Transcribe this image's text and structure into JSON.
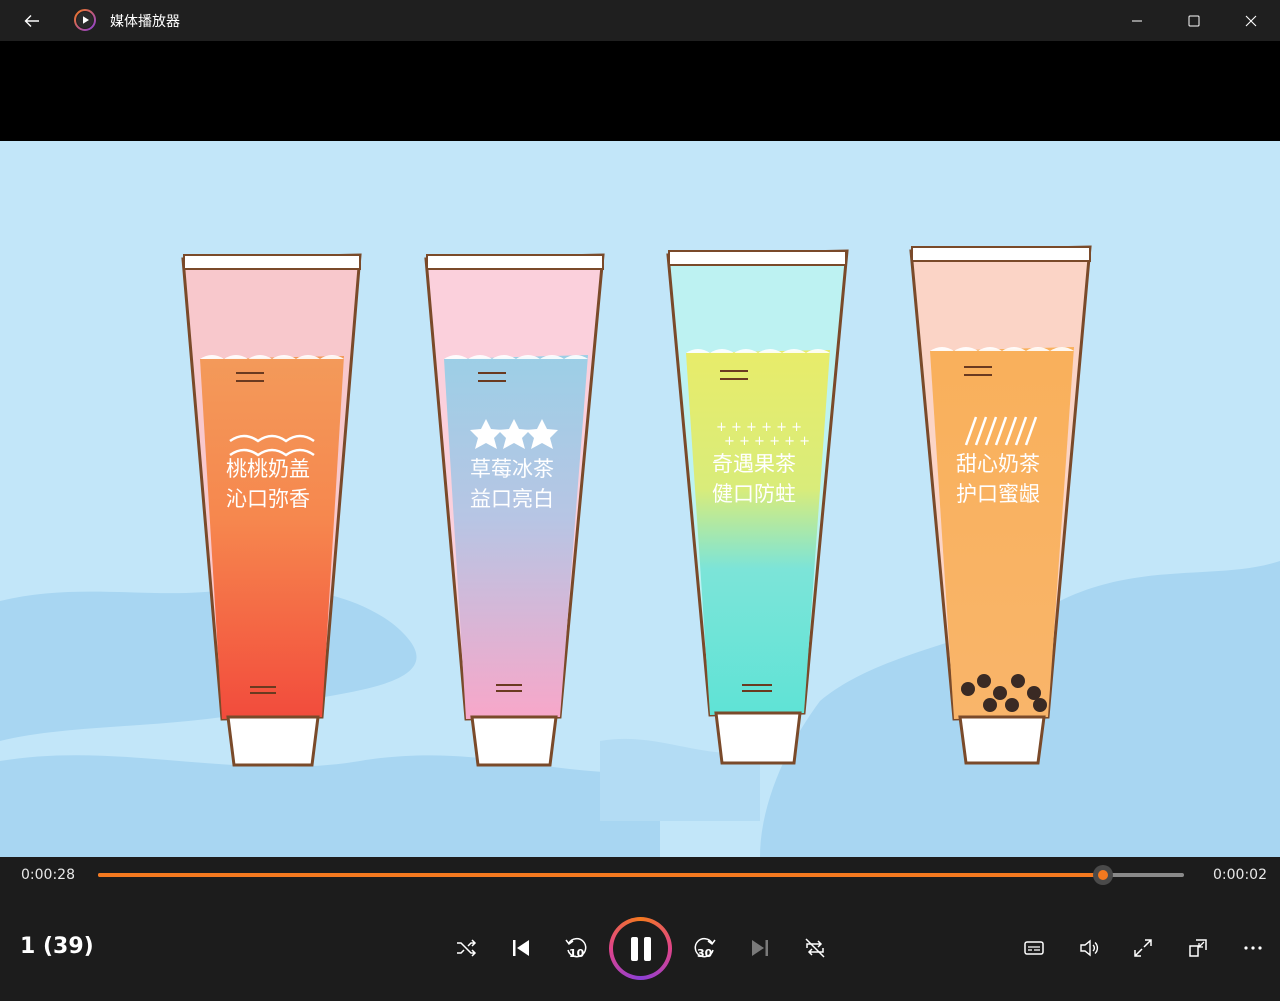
{
  "window": {
    "title": "媒体播放器",
    "accent_color": "#f4791f"
  },
  "video": {
    "tubes": [
      {
        "line1": "桃桃奶盖",
        "line2": "沁口弥香",
        "top_color": "#f8c8cc",
        "mid_color": "#f39a5a",
        "bottom_color": "#f24b3c"
      },
      {
        "line1": "草莓冰茶",
        "line2": "益口亮白",
        "top_color": "#fbd0dc",
        "mid_color": "#9ccfe6",
        "bottom_color": "#f8a7c9"
      },
      {
        "line1": "奇遇果茶",
        "line2": "健口防蛀",
        "top_color": "#bdf2f2",
        "mid_color": "#e8ec6a",
        "bottom_color": "#5fe3d6"
      },
      {
        "line1": "甜心奶茶",
        "line2": "护口蜜龈",
        "top_color": "#fbd4c6",
        "mid_color": "#f9b05b",
        "bottom_color": "#f9a861"
      }
    ]
  },
  "playback": {
    "elapsed": "0:00:28",
    "remaining": "0:00:02",
    "progress": 0.925,
    "counter": "1 (39)"
  },
  "icons": {
    "back": "back-arrow-icon",
    "minimize": "minimize-icon",
    "maximize": "maximize-icon",
    "close": "close-icon",
    "shuffle": "shuffle-icon",
    "previous": "previous-icon",
    "rewind": "rewind-10-icon",
    "pause": "pause-icon",
    "forward": "forward-30-icon",
    "next": "next-icon",
    "repeat": "repeat-off-icon",
    "subtitles": "subtitles-icon",
    "volume": "volume-icon",
    "fullscreen": "fullscreen-icon",
    "miniplayer": "miniplayer-icon",
    "more": "more-icon"
  },
  "labels": {
    "rewind_seconds": "10",
    "forward_seconds": "30"
  }
}
